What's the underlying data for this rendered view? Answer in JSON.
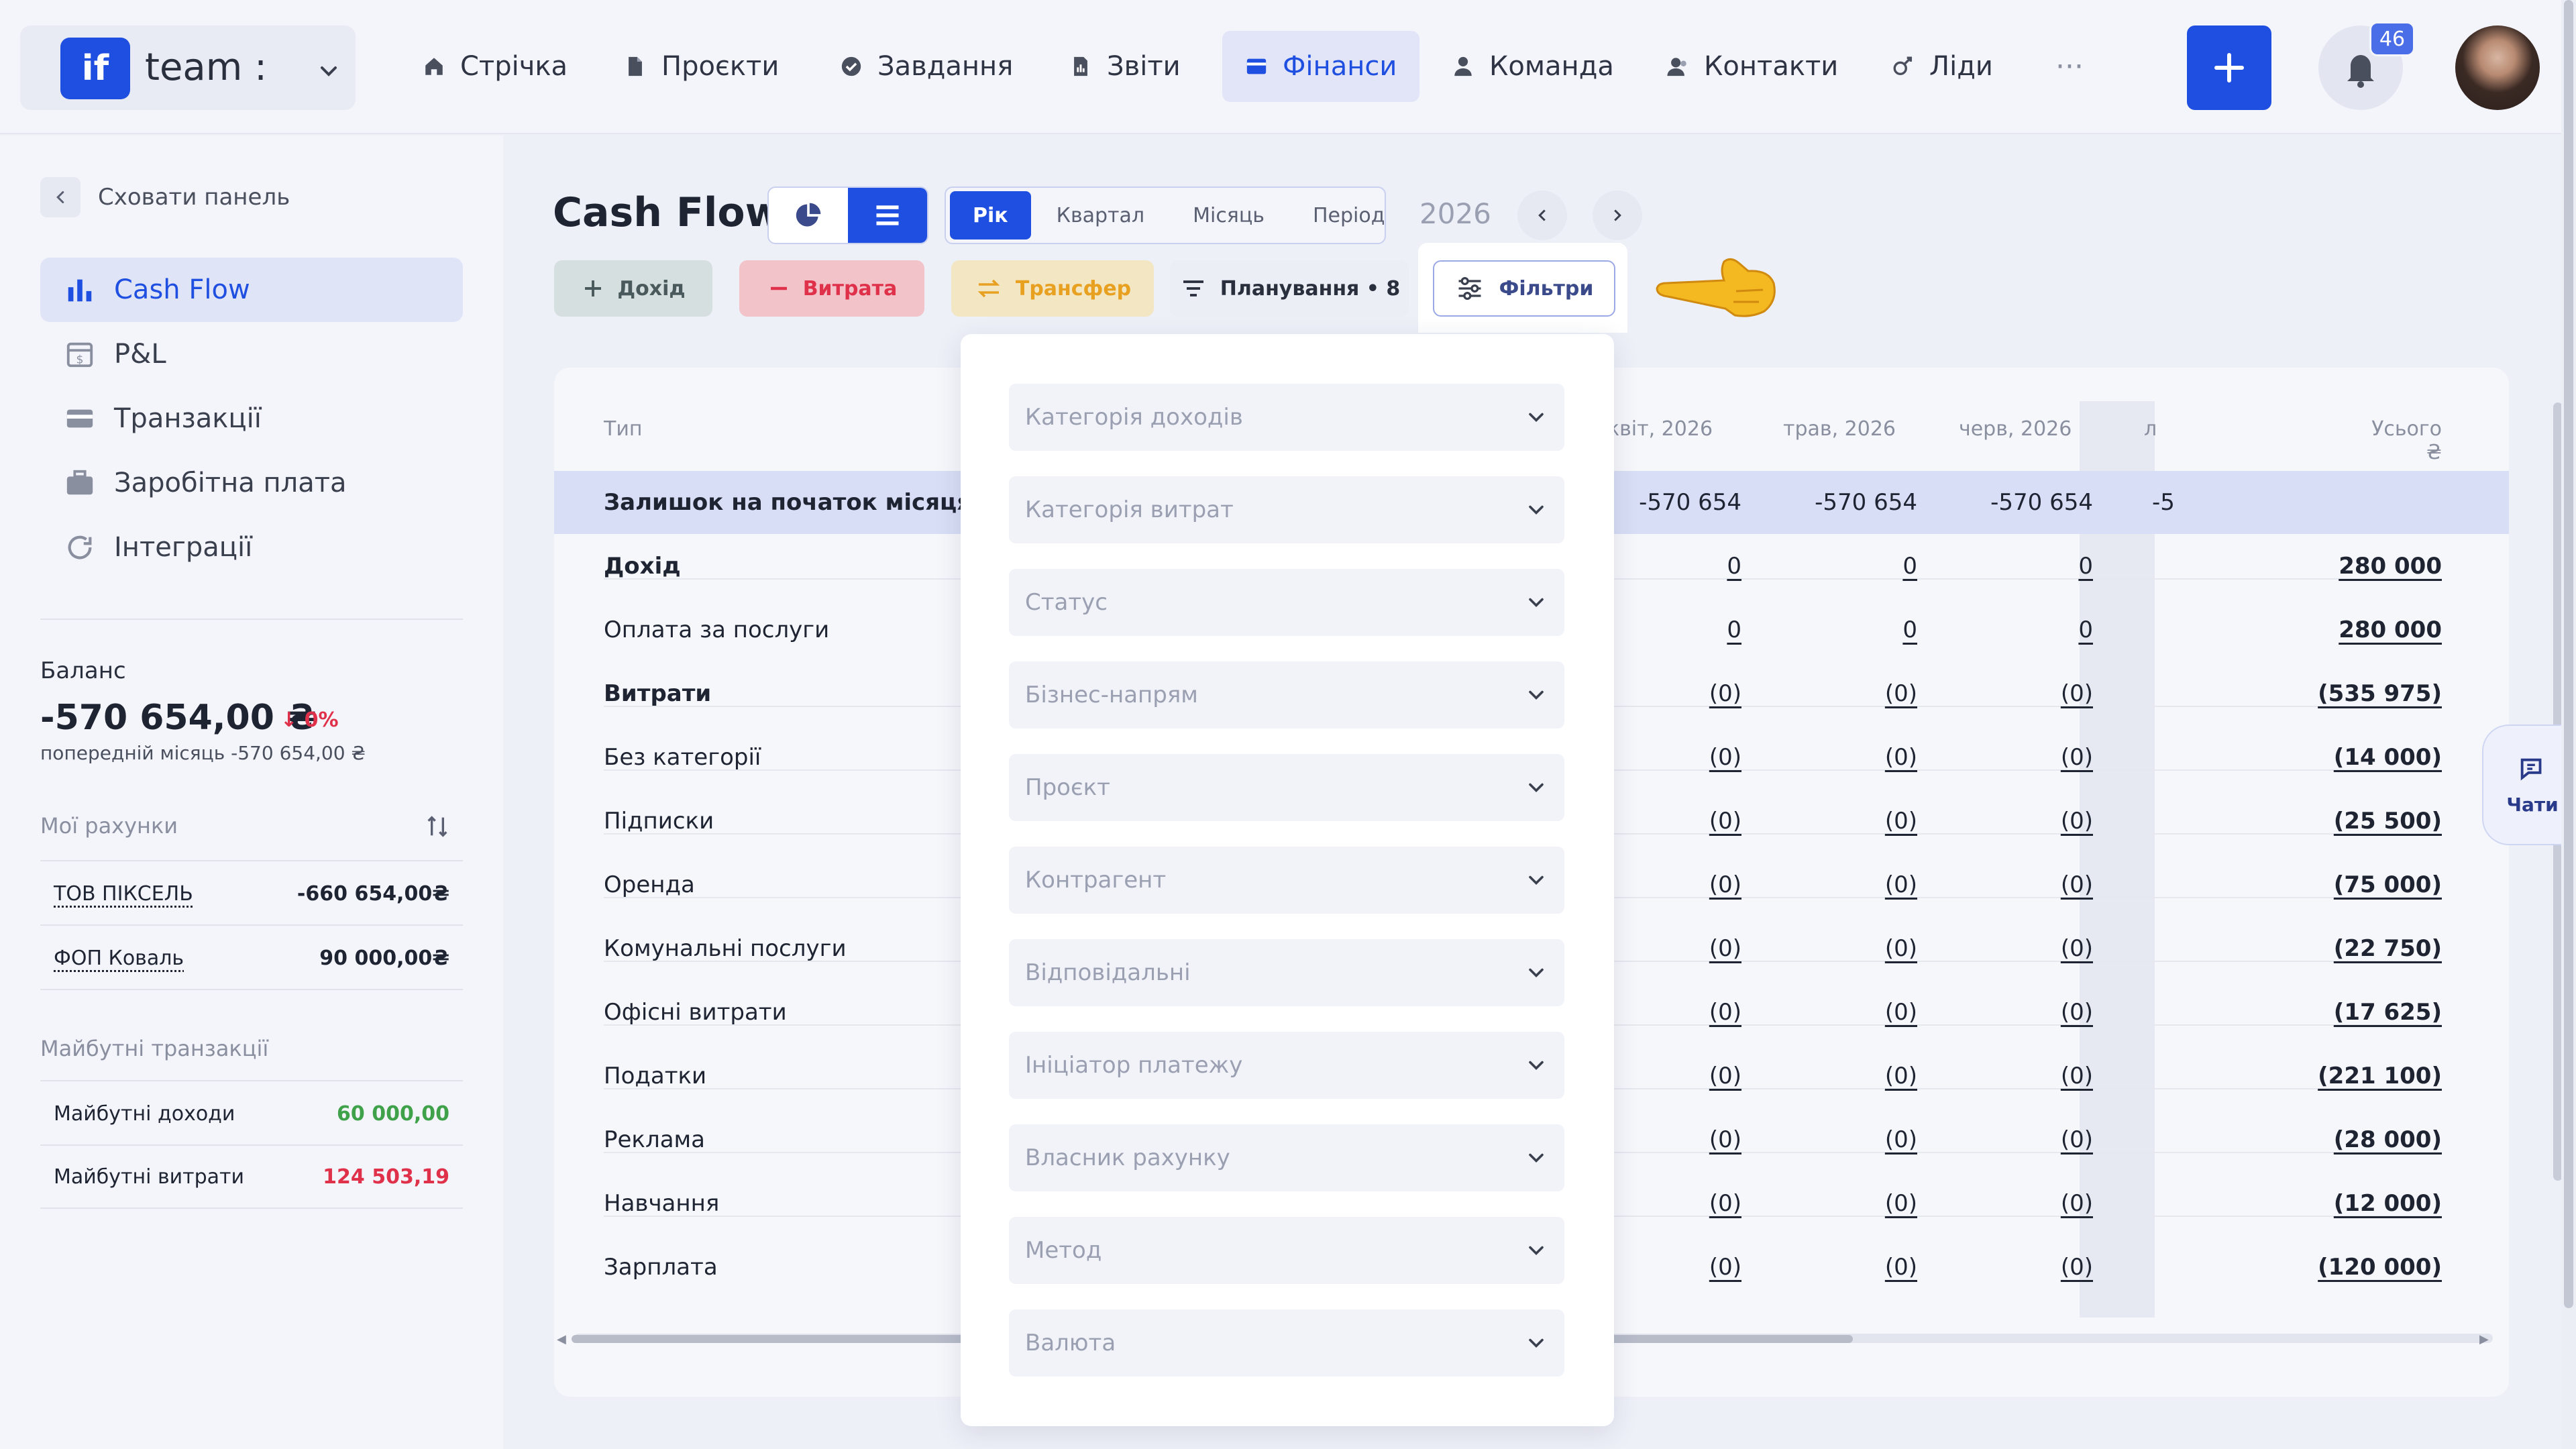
{
  "topbar": {
    "brand": {
      "logo": "if",
      "name": "team :"
    },
    "nav": [
      {
        "label": "Стрічка",
        "icon": "home-icon"
      },
      {
        "label": "Проєкти",
        "icon": "document-icon"
      },
      {
        "label": "Завдання",
        "icon": "check-circle-icon"
      },
      {
        "label": "Звіти",
        "icon": "chart-file-icon"
      },
      {
        "label": "Фінанси",
        "icon": "wallet-icon",
        "active": true
      },
      {
        "label": "Команда",
        "icon": "person-icon"
      },
      {
        "label": "Контакти",
        "icon": "contacts-icon"
      },
      {
        "label": "Ліди",
        "icon": "leads-icon"
      }
    ],
    "more": "···",
    "notifications_count": "46"
  },
  "sidebar": {
    "hide_label": "Сховати панель",
    "items": [
      {
        "label": "Cash Flow",
        "icon": "bar-chart-icon",
        "active": true
      },
      {
        "label": "P&L",
        "icon": "calendar-dollar-icon"
      },
      {
        "label": "Транзакції",
        "icon": "card-icon"
      },
      {
        "label": "Заробітна плата",
        "icon": "briefcase-icon"
      },
      {
        "label": "Інтеграції",
        "icon": "refresh-icon"
      }
    ],
    "balance": {
      "title": "Баланс",
      "value": "-570 654,00 ₴",
      "delta": "0%",
      "prev": "попередній місяць -570 654,00 ₴"
    },
    "accounts": {
      "title": "Мої рахунки",
      "items": [
        {
          "name": "ТОВ ПІКСЕЛЬ",
          "value": "-660 654,00₴"
        },
        {
          "name": "ФОП Коваль",
          "value": "90 000,00₴"
        }
      ]
    },
    "future": {
      "title": "Майбутні транзакції",
      "items": [
        {
          "name": "Майбутні доходи",
          "value": "60 000,00",
          "color": "#3fa24a"
        },
        {
          "name": "Майбутні витрати",
          "value": "124 503,19",
          "color": "#e0314a"
        }
      ]
    }
  },
  "main": {
    "title": "Cash Flow",
    "periods": [
      "Рік",
      "Квартал",
      "Місяць",
      "Період"
    ],
    "active_period": "Рік",
    "year": "2026",
    "actions": {
      "income": "Дохід",
      "expense": "Витрата",
      "transfer": "Трансфер",
      "planning": "Планування • 8",
      "filters": "Фільтри"
    },
    "table": {
      "col_type": "Тип",
      "months": [
        "квіт, 2026",
        "трав, 2026",
        "черв, 2026",
        "л"
      ],
      "col_total": "Усього ₴",
      "rows": [
        {
          "label": "Залишок на початок місяця",
          "bold": true,
          "highlight": true,
          "values": [
            "-570 654",
            "-570 654",
            "-570 654",
            "-5"
          ],
          "total": ""
        },
        {
          "label": "Дохід",
          "bold": true,
          "values": [
            "0",
            "0",
            "0"
          ],
          "total": "280 000"
        },
        {
          "label": "Оплата за послуги",
          "values": [
            "0",
            "0",
            "0"
          ],
          "total": "280 000"
        },
        {
          "label": "Витрати",
          "bold": true,
          "values": [
            "(0)",
            "(0)",
            "(0)"
          ],
          "total": "(535 975)"
        },
        {
          "label": "Без категорії",
          "values": [
            "(0)",
            "(0)",
            "(0)"
          ],
          "total": "(14 000)"
        },
        {
          "label": "Підписки",
          "values": [
            "(0)",
            "(0)",
            "(0)"
          ],
          "total": "(25 500)"
        },
        {
          "label": "Оренда",
          "values": [
            "(0)",
            "(0)",
            "(0)"
          ],
          "total": "(75 000)"
        },
        {
          "label": "Комунальні послуги",
          "values": [
            "(0)",
            "(0)",
            "(0)"
          ],
          "total": "(22 750)"
        },
        {
          "label": "Офісні витрати",
          "values": [
            "(0)",
            "(0)",
            "(0)"
          ],
          "total": "(17 625)"
        },
        {
          "label": "Податки",
          "values": [
            "(0)",
            "(0)",
            "(0)"
          ],
          "total": "(221 100)"
        },
        {
          "label": "Реклама",
          "values": [
            "(0)",
            "(0)",
            "(0)"
          ],
          "total": "(28 000)"
        },
        {
          "label": "Навчання",
          "values": [
            "(0)",
            "(0)",
            "(0)"
          ],
          "total": "(12 000)"
        },
        {
          "label": "Зарплата",
          "values": [
            "(0)",
            "(0)",
            "(0)"
          ],
          "total": "(120 000)"
        }
      ]
    },
    "filters_dropdown": [
      "Категорія доходів",
      "Категорія витрат",
      "Статус",
      "Бізнес-напрям",
      "Проєкт",
      "Контрагент",
      "Відповідальні",
      "Ініціатор платежу",
      "Власник рахунку",
      "Метод",
      "Валюта"
    ]
  },
  "chat": {
    "label": "Чати"
  }
}
